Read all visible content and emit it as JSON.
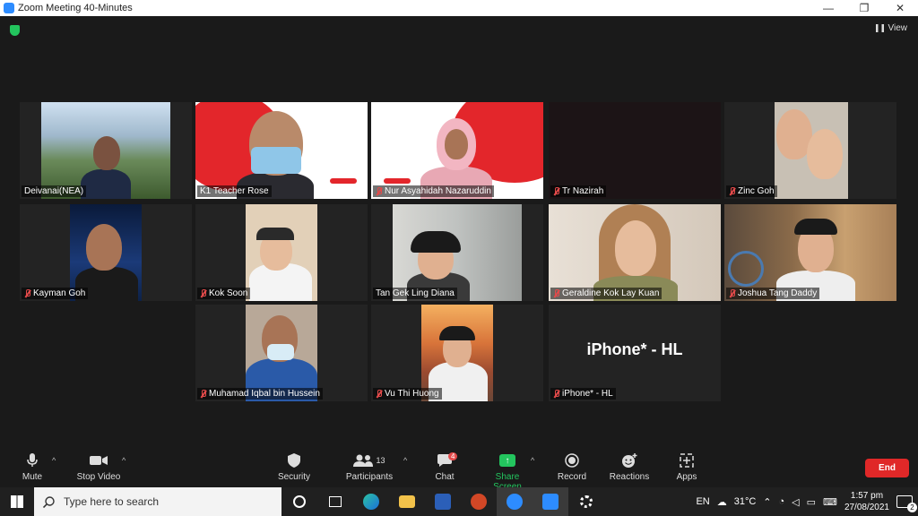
{
  "window": {
    "title": "Zoom Meeting 40-Minutes",
    "minimize": "—",
    "restore": "❐",
    "close": "✕"
  },
  "meeting": {
    "view_label": "View",
    "participants": [
      {
        "name": "Deivanai(NEA)",
        "muted": false
      },
      {
        "name": "K1 Teacher Rose",
        "muted": false,
        "active": true
      },
      {
        "name": "Nur Asyahidah Nazaruddin",
        "muted": true
      },
      {
        "name": "Tr Nazirah",
        "muted": true
      },
      {
        "name": "Zinc Goh",
        "muted": true
      },
      {
        "name": "Kayman Goh",
        "muted": true
      },
      {
        "name": "Kok Soon",
        "muted": true
      },
      {
        "name": "Tan Gek Ling Diana",
        "muted": false
      },
      {
        "name": "Geraldine Kok Lay Kuan",
        "muted": true
      },
      {
        "name": "Joshua Tang Daddy",
        "muted": true
      },
      {
        "name": "Muhamad Iqbal bin Hussein",
        "muted": true
      },
      {
        "name": "Vu Thi Huong",
        "muted": true
      },
      {
        "name": "iPhone* - HL",
        "muted": true,
        "display_name": "iPhone* - HL"
      }
    ]
  },
  "toolbar": {
    "mute": "Mute",
    "stop_video": "Stop Video",
    "security": "Security",
    "participants": "Participants",
    "participants_count": "13",
    "chat": "Chat",
    "chat_badge": "4",
    "share_screen": "Share Screen",
    "record": "Record",
    "reactions": "Reactions",
    "apps": "Apps",
    "end": "End"
  },
  "taskbar": {
    "search_placeholder": "Type here to search",
    "language": "EN",
    "weather": "31°C",
    "time": "1:57 pm",
    "date": "27/08/2021",
    "notifications": "2"
  },
  "colors": {
    "accent_green": "#23c55e",
    "end_red": "#e02828",
    "active_speaker": "#e8e25a"
  }
}
